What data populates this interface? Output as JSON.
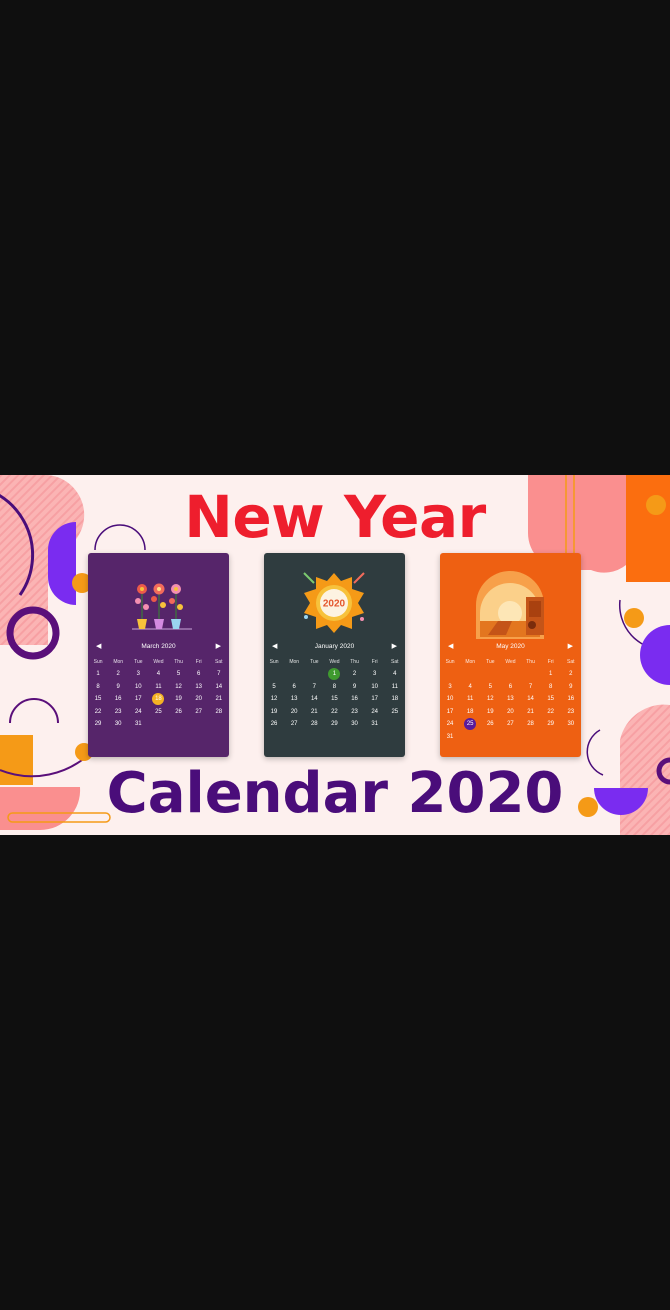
{
  "headline_top": "New Year",
  "headline_bottom": "Calendar 2020",
  "colors": {
    "headline_top": "#ee1e2d",
    "headline_bottom": "#4a0d7a",
    "banner_bg": "#fdf0ee",
    "purple_card": "#56256a",
    "dark_card": "#2f3c3f",
    "orange_card": "#ee6012"
  },
  "weekdays": [
    "Sun",
    "Mon",
    "Tue",
    "Wed",
    "Thu",
    "Fri",
    "Sat"
  ],
  "calendars": [
    {
      "month": "March 2020",
      "prev_icon": "triangle-left-icon",
      "next_icon": "triangle-right-icon",
      "art_icon": "flower-pots-icon",
      "selected": "18",
      "selected_color": "#f5b324",
      "days": [
        "1",
        "2",
        "3",
        "4",
        "5",
        "6",
        "7",
        "8",
        "9",
        "10",
        "11",
        "12",
        "13",
        "14",
        "15",
        "16",
        "17",
        "18",
        "19",
        "20",
        "21",
        "22",
        "23",
        "24",
        "25",
        "26",
        "27",
        "28",
        "29",
        "30",
        "31"
      ]
    },
    {
      "month": "January 2020",
      "prev_icon": "triangle-left-icon",
      "next_icon": "triangle-right-icon",
      "art_icon": "fireworks-2020-badge-icon",
      "art_label": "2020",
      "selected": "1",
      "selected_color": "#3f9a2f",
      "days": [
        "",
        "",
        "",
        "1",
        "2",
        "3",
        "4",
        "5",
        "6",
        "7",
        "8",
        "9",
        "10",
        "11",
        "12",
        "13",
        "14",
        "15",
        "16",
        "17",
        "18",
        "19",
        "20",
        "21",
        "22",
        "23",
        "24",
        "25",
        "26",
        "27",
        "28",
        "29",
        "30",
        "31"
      ]
    },
    {
      "month": "May 2020",
      "prev_icon": "triangle-left-icon",
      "next_icon": "triangle-right-icon",
      "art_icon": "beach-sunset-icon",
      "selected": "25",
      "selected_color": "#5a1a9a",
      "days": [
        "",
        "",
        "",
        "",
        "",
        "1",
        "2",
        "3",
        "4",
        "5",
        "6",
        "7",
        "8",
        "9",
        "10",
        "11",
        "12",
        "13",
        "14",
        "15",
        "16",
        "17",
        "18",
        "19",
        "20",
        "21",
        "22",
        "23",
        "24",
        "25",
        "26",
        "27",
        "28",
        "29",
        "30",
        "31"
      ]
    }
  ]
}
